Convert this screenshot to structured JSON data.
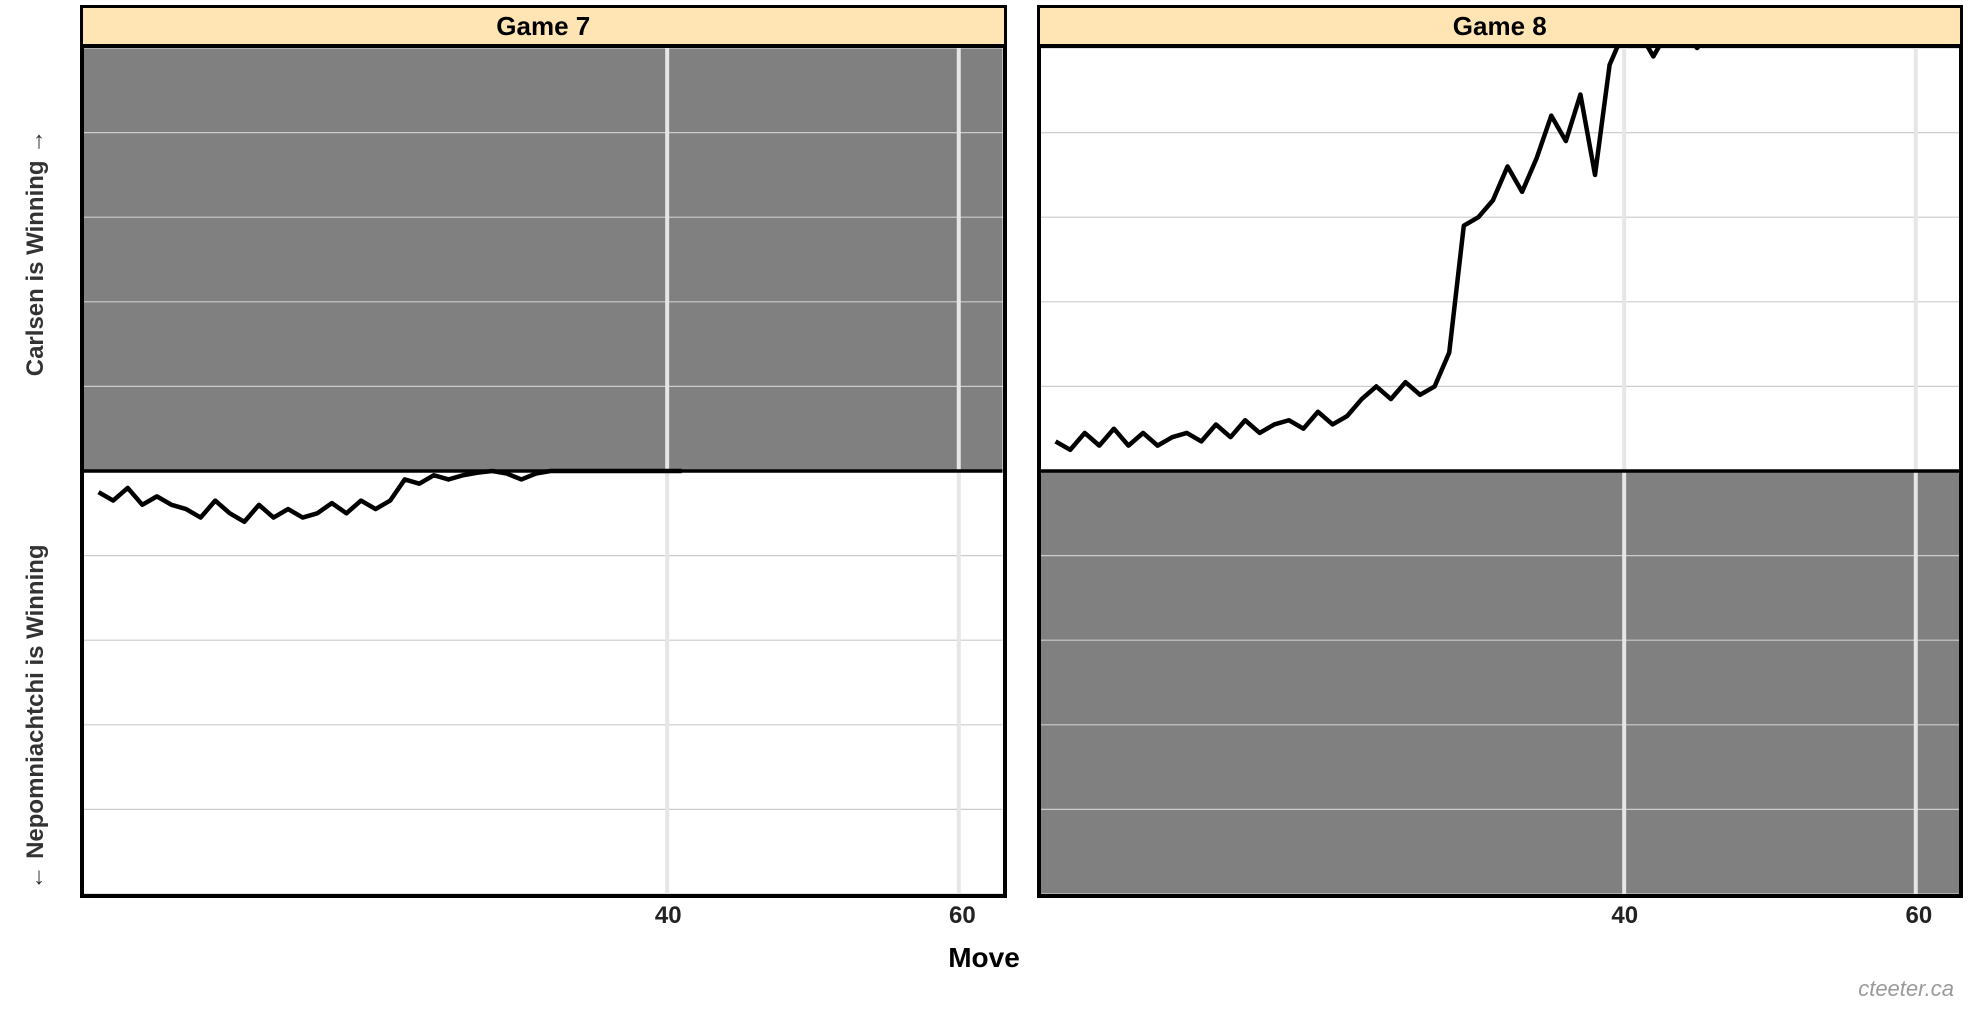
{
  "chart_data": [
    {
      "type": "line",
      "title": "Game 7",
      "xlabel": "Move",
      "ylabel_top": "Carlsen is Winning →",
      "ylabel_bottom": "← Nepomniachtchi is Winning",
      "xlim": [
        0,
        63
      ],
      "ylim": [
        -5,
        5
      ],
      "xticks": [
        40,
        60
      ],
      "yticks": [],
      "hgrid": [
        -5,
        -4,
        -3,
        -2,
        -1,
        0,
        1,
        2,
        3,
        4,
        5
      ],
      "vlines": [
        40,
        60
      ],
      "shade_region": "top",
      "zero_line": true,
      "x": [
        1,
        2,
        3,
        4,
        5,
        6,
        7,
        8,
        9,
        10,
        11,
        12,
        13,
        14,
        15,
        16,
        17,
        18,
        19,
        20,
        21,
        22,
        23,
        24,
        25,
        26,
        27,
        28,
        29,
        30,
        31,
        32,
        33,
        34,
        35,
        36,
        37,
        38,
        39,
        40,
        41
      ],
      "values": [
        -0.25,
        -0.35,
        -0.2,
        -0.4,
        -0.3,
        -0.4,
        -0.45,
        -0.55,
        -0.35,
        -0.5,
        -0.6,
        -0.4,
        -0.55,
        -0.45,
        -0.55,
        -0.5,
        -0.38,
        -0.5,
        -0.35,
        -0.45,
        -0.35,
        -0.1,
        -0.15,
        -0.05,
        -0.1,
        -0.05,
        -0.02,
        0.0,
        -0.03,
        -0.1,
        -0.03,
        0.0,
        0.0,
        0.0,
        0.0,
        0.0,
        0.0,
        0.0,
        0.0,
        0.0,
        0.0
      ]
    },
    {
      "type": "line",
      "title": "Game 8",
      "xlabel": "Move",
      "ylabel_top": "Carlsen is Winning →",
      "ylabel_bottom": "← Nepomniachtchi is Winning",
      "xlim": [
        0,
        63
      ],
      "ylim": [
        -5,
        5
      ],
      "xticks": [
        40,
        60
      ],
      "yticks": [],
      "hgrid": [
        -5,
        -4,
        -3,
        -2,
        -1,
        0,
        1,
        2,
        3,
        4,
        5
      ],
      "vlines": [
        40,
        60
      ],
      "shade_region": "bottom",
      "zero_line": true,
      "x": [
        1,
        2,
        3,
        4,
        5,
        6,
        7,
        8,
        9,
        10,
        11,
        12,
        13,
        14,
        15,
        16,
        17,
        18,
        19,
        20,
        21,
        22,
        23,
        24,
        25,
        26,
        27,
        28,
        29,
        30,
        31,
        32,
        33,
        34,
        35,
        36,
        37,
        38,
        39,
        40,
        41,
        42,
        43,
        44,
        45,
        46
      ],
      "values": [
        0.35,
        0.25,
        0.45,
        0.3,
        0.5,
        0.3,
        0.45,
        0.3,
        0.4,
        0.45,
        0.35,
        0.55,
        0.4,
        0.6,
        0.45,
        0.55,
        0.6,
        0.5,
        0.7,
        0.55,
        0.65,
        0.85,
        1.0,
        0.85,
        1.05,
        0.9,
        1.0,
        1.4,
        2.9,
        3.0,
        3.2,
        3.6,
        3.3,
        3.7,
        4.2,
        3.9,
        4.45,
        3.5,
        4.8,
        5.3,
        5.3,
        4.9,
        5.3,
        5.3,
        5.0,
        5.3
      ]
    }
  ],
  "labels": {
    "xlabel": "Move",
    "ylabel_top": "Carlsen is Winning →",
    "ylabel_bottom": "← Nepomniachtchi is Winning",
    "credit": "cteeter.ca"
  },
  "colors": {
    "strip_bg": "#ffe5b4",
    "shade": "#808080",
    "grid": "#cccccc",
    "line": "#000000",
    "zero": "#000000",
    "vline": "#e6e6e6",
    "credit": "#9a9a9a"
  }
}
